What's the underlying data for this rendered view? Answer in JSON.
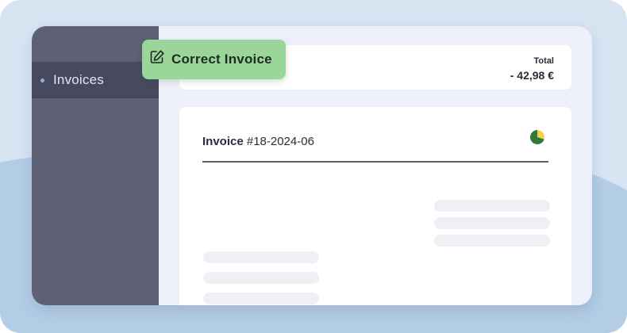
{
  "sidebar": {
    "items": [
      {
        "label": "Invoices",
        "icon": "bullet-dot-icon",
        "active": true
      }
    ]
  },
  "toast": {
    "label": "Correct Invoice",
    "icon": "edit-icon",
    "color": "#9ad59a"
  },
  "summary": {
    "total_label": "Total",
    "total_value": "- 42,98 €"
  },
  "invoice": {
    "title_bold": "Invoice",
    "number": " #18-2024-06",
    "status_icon": "partial-status-icon"
  },
  "colors": {
    "sidebar": "#5e6074",
    "sidebar_active": "#474a5e",
    "background": "#d7e5f3",
    "accent_green": "#9ad59a"
  }
}
